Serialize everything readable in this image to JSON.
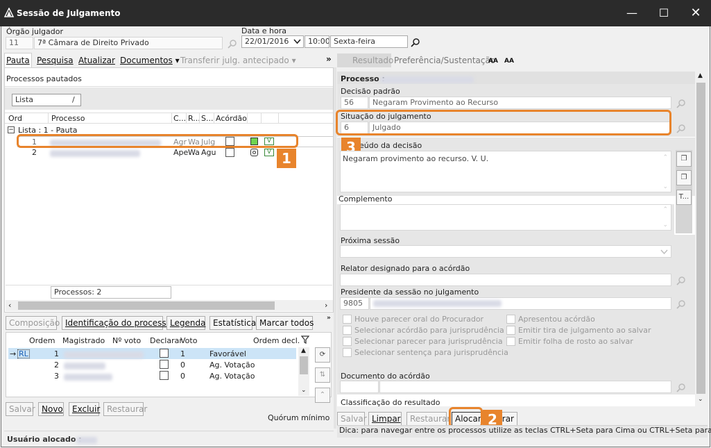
{
  "window": {
    "title": "Sessão de Julgamento"
  },
  "top": {
    "orgao_label": "Órgão julgador",
    "orgao_code": "11",
    "orgao_name": "7ª Câmara de Direito Privado",
    "data_hora_label": "Data e hora",
    "date": "22/01/2016",
    "time": "10:00",
    "weekday": "Sexta-feira"
  },
  "toolbar": {
    "pauta": "Pauta",
    "pesquisa": "Pesquisa",
    "atualizar": "Atualizar",
    "documentos": "Documentos",
    "transferir": "Transferir julg. antecipado",
    "more": "»",
    "resultado": "Resultado",
    "preferencia": "Preferência/Sustentação",
    "font_inc": "AA",
    "font_dec": "AA"
  },
  "processos": {
    "section_label": "Processos pautados",
    "view_select": "Lista",
    "slash": "/",
    "columns": [
      "Ord",
      "Processo",
      "C...",
      "R...",
      "S...",
      "Acórdão"
    ],
    "group_label": "Lista : 1 - Pauta",
    "rows": [
      {
        "ord": "1",
        "c": "Agr",
        "r": "Wa",
        "s": "Julg"
      },
      {
        "ord": "2",
        "c": "Ape",
        "r": "Wa",
        "s": "Agu"
      }
    ],
    "count_label": "Processos: 2"
  },
  "composicao": {
    "tabs": [
      "Composição",
      "Identificação do processo",
      "Legenda",
      "Estatística",
      "Marcar todos"
    ],
    "more": "»",
    "columns": [
      "Ordem",
      "Magistrado",
      "Nº voto",
      "Declarar",
      "Voto",
      "Ordem decl."
    ],
    "rows": [
      {
        "tag": "RL",
        "ordem": "1",
        "nvoto": "1",
        "voto": "Favorável"
      },
      {
        "tag": "",
        "ordem": "2",
        "nvoto": "0",
        "voto": "Ag. Votação"
      },
      {
        "tag": "",
        "ordem": "3",
        "nvoto": "0",
        "voto": "Ag. Votação"
      }
    ],
    "buttons": [
      "Salvar",
      "Novo",
      "Excluir",
      "Restaurar"
    ],
    "quorum": "Quórum mínimo",
    "usuario_label": "Usuário alocado :"
  },
  "detail": {
    "processo_label": "Processo :",
    "decisao_label": "Decisão padrão",
    "decisao_code": "56",
    "decisao_text": "Negaram Provimento ao Recurso",
    "situacao_label": "Situação do julgamento",
    "situacao_code": "6",
    "situacao_text": "Julgado",
    "conteudo_label": "Conteúdo da decisão",
    "conteudo_label_visible": "eúdo da decisão",
    "conteudo_text": "Negaram provimento ao recurso. V. U.",
    "complemento_label": "Complemento",
    "proxima_label": "Próxima sessão",
    "relator_label": "Relator designado para o acórdão",
    "presidente_label": "Presidente da sessão no julgamento",
    "presidente_code": "9805",
    "checks_left": [
      "Houve parecer oral do Procurador",
      "Selecionar acórdão para jurisprudência",
      "Selecionar parecer para jurisprudência",
      "Selecionar sentença para jurisprudência"
    ],
    "checks_right": [
      "Apresentou acórdão",
      "Emitir tira de julgamento ao salvar",
      "Emitir folha de rosto ao salvar"
    ],
    "documento_label": "Documento do acórdão",
    "classificacao_label": "Classificação do resultado",
    "buttons": [
      "Salvar",
      "Limpar",
      "Restaurar",
      "Alocar",
      "rar"
    ],
    "dica": "Dica: para navegar entre os processos utilize as teclas CTRL+Seta para Cima ou CTRL+Seta para Baixo."
  },
  "callouts": {
    "one": "1",
    "two": "2",
    "three": "3"
  },
  "colors": {
    "accent": "#e8842c",
    "selection": "#cce4f7",
    "title_bg": "#2b2b2b"
  }
}
